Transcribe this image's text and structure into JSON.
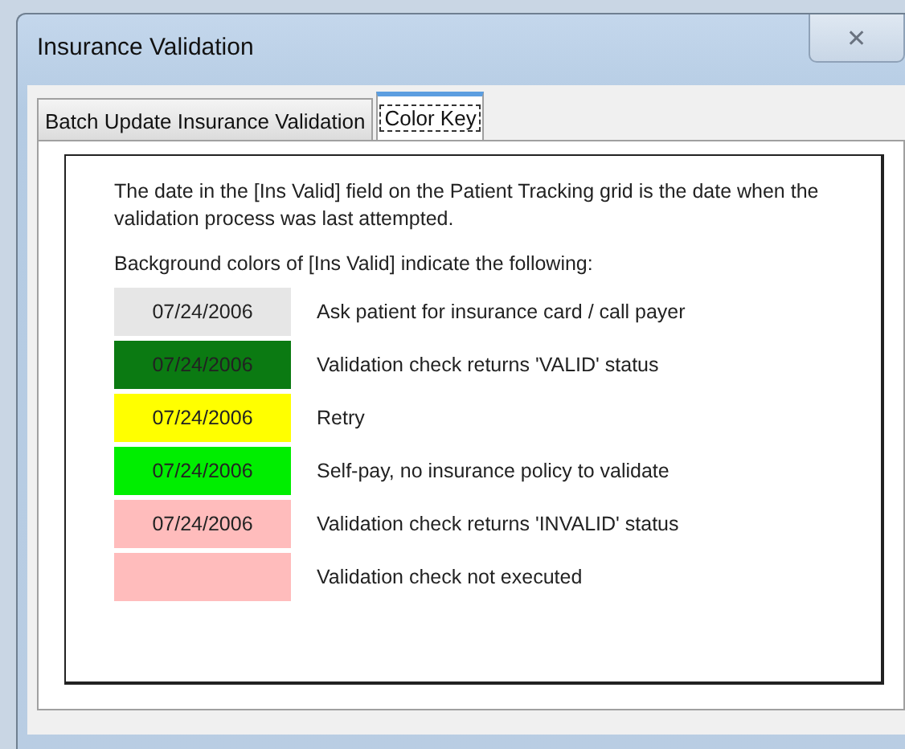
{
  "window": {
    "title": "Insurance Validation",
    "close": "✕"
  },
  "tabs": [
    {
      "label": "Batch Update Insurance Validation",
      "selected": false
    },
    {
      "label": "Color Key",
      "selected": true
    }
  ],
  "intro": "The date in the [Ins Valid] field on the Patient Tracking grid is the date when the validation process was last attempted.",
  "legend_heading": "Background colors of [Ins Valid] indicate the following:",
  "legend": [
    {
      "date": "07/24/2006",
      "color": "#e6e6e6",
      "description": "Ask patient for insurance card / call payer"
    },
    {
      "date": "07/24/2006",
      "color": "#0b7a12",
      "description": "Validation check returns 'VALID' status"
    },
    {
      "date": "07/24/2006",
      "color": "#ffff00",
      "description": "Retry"
    },
    {
      "date": "07/24/2006",
      "color": "#00ee00",
      "description": "Self-pay, no insurance policy to validate"
    },
    {
      "date": "07/24/2006",
      "color": "#ffbcbc",
      "description": "Validation check returns 'INVALID' status"
    },
    {
      "color": "#ffbcbc",
      "description": "Validation check not executed"
    }
  ]
}
